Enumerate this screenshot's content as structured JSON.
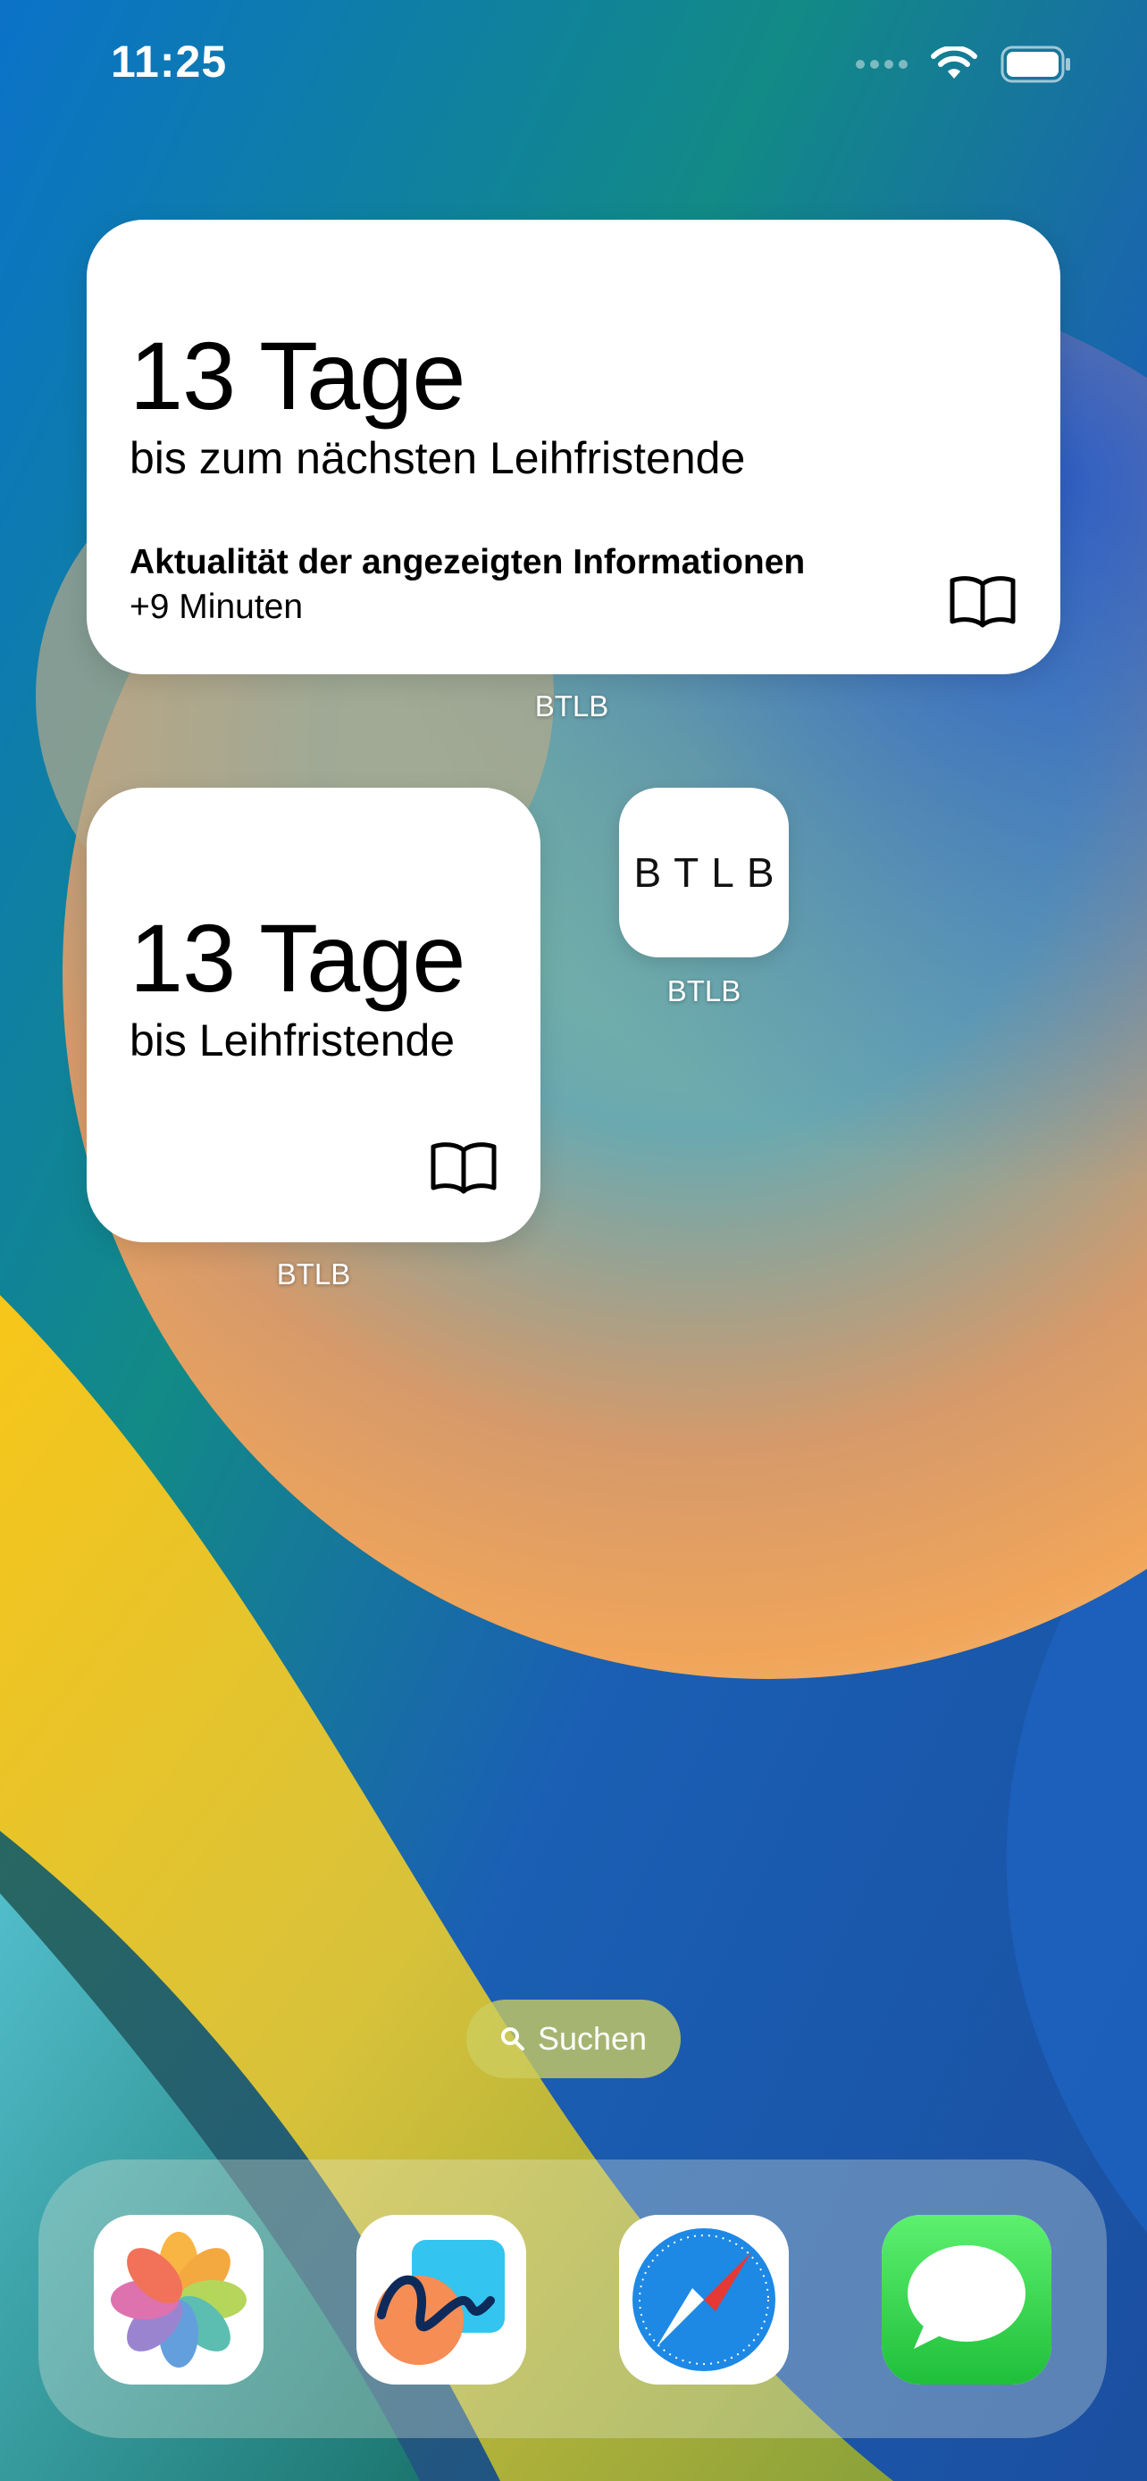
{
  "status_bar": {
    "time": "11:25"
  },
  "widgets": {
    "large": {
      "count": "13 Tage",
      "subtitle": "bis zum nächsten Leihfristende",
      "meta_title": "Aktualität der angezeigten Informationen",
      "meta_value": "+9 Minuten",
      "label": "BTLB"
    },
    "small": {
      "count": "13 Tage",
      "subtitle": "bis Leihfristende",
      "label": "BTLB"
    }
  },
  "app": {
    "icon_text": "BTLB",
    "label": "BTLB"
  },
  "search": {
    "label": "Suchen"
  },
  "dock": {
    "apps": [
      {
        "name": "Fotos",
        "icon": "photos-icon"
      },
      {
        "name": "Freeform",
        "icon": "freeform-icon"
      },
      {
        "name": "Safari",
        "icon": "safari-icon"
      },
      {
        "name": "Nachrichten",
        "icon": "messages-icon"
      }
    ]
  },
  "colors": {
    "wallpaper_blue": "#1667c9",
    "wallpaper_teal": "#1f8a7f",
    "wallpaper_yellow": "#f2c21b",
    "wallpaper_orange": "#f0a55a",
    "messages_green": "#34c759",
    "safari_blue": "#1e88e5"
  }
}
